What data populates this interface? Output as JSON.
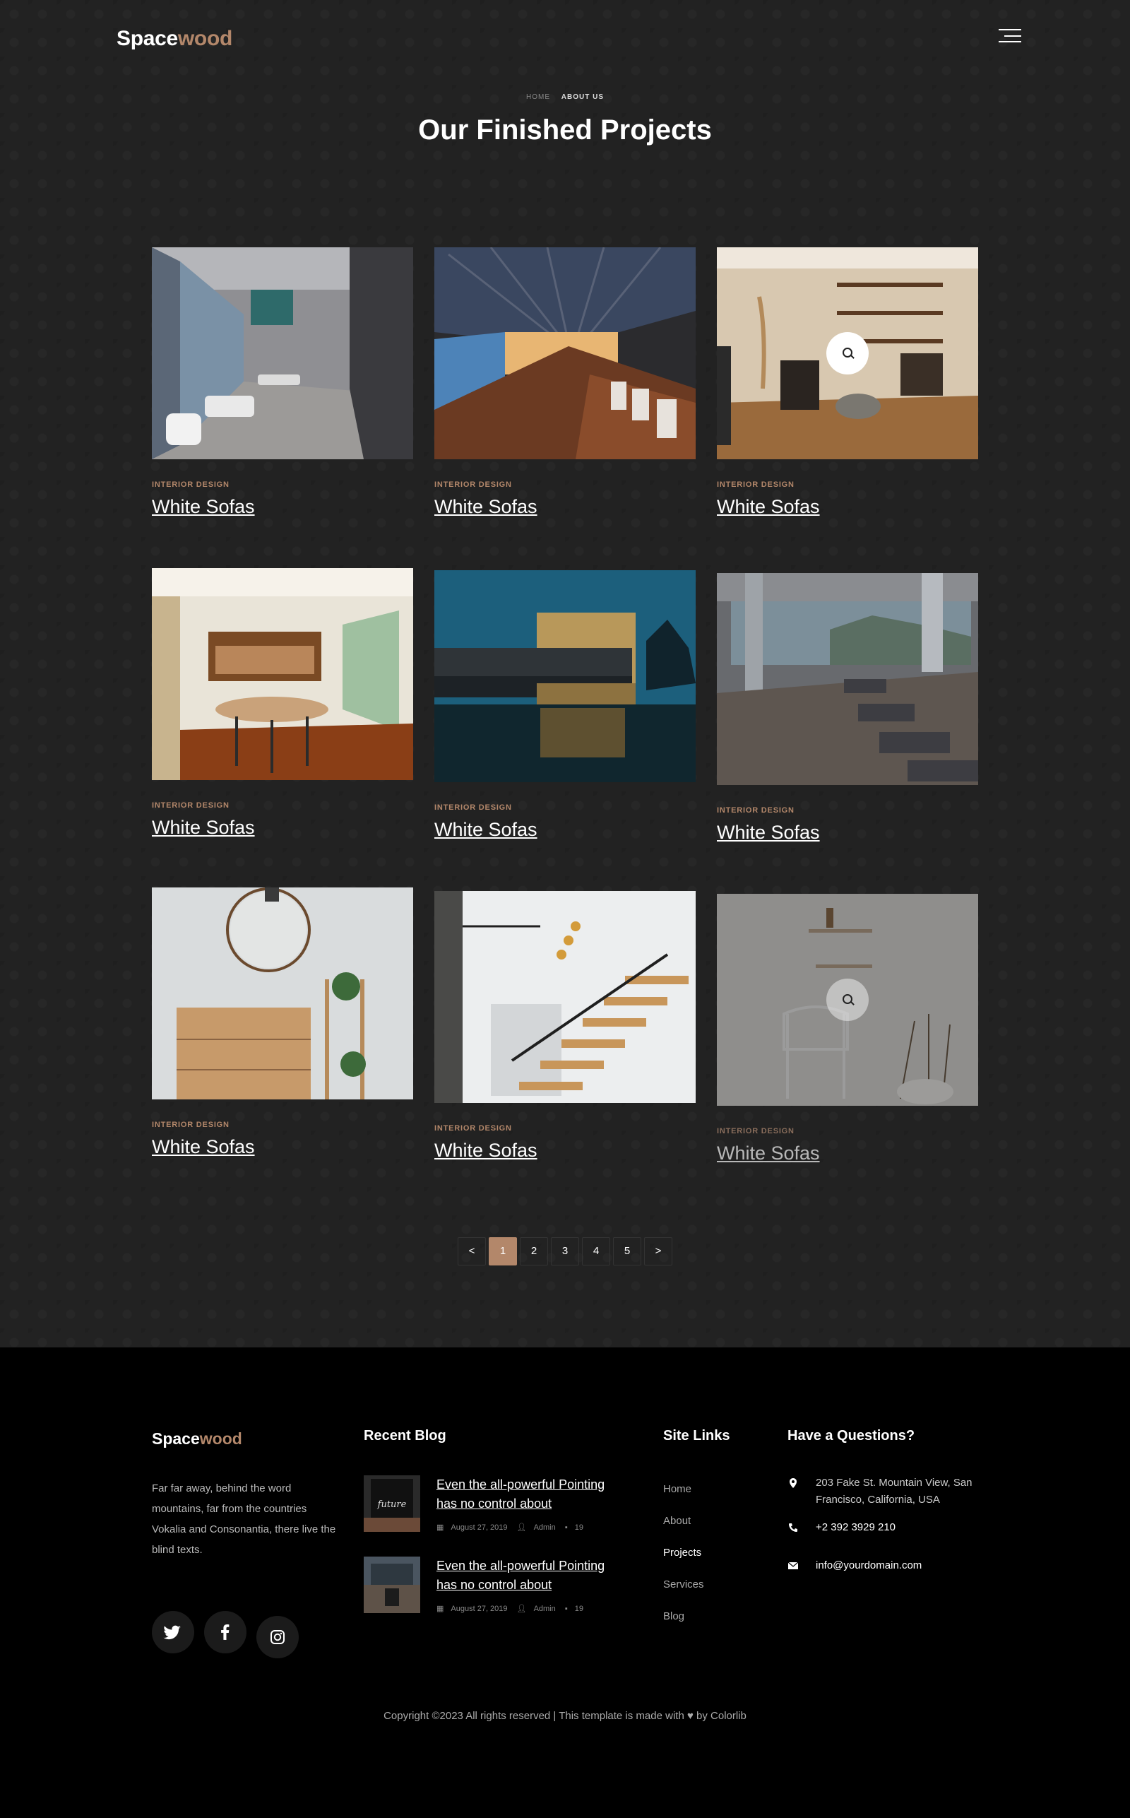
{
  "brand": {
    "part1": "Space",
    "part2": "wood"
  },
  "breadcrumb": {
    "home": "HOME",
    "current": "ABOUT US"
  },
  "page_title": "Our Finished Projects",
  "projects": [
    {
      "category": "INTERIOR DESIGN",
      "title": "White Sofas"
    },
    {
      "category": "INTERIOR DESIGN",
      "title": "White Sofas"
    },
    {
      "category": "INTERIOR DESIGN",
      "title": "White Sofas"
    },
    {
      "category": "INTERIOR DESIGN",
      "title": "White Sofas"
    },
    {
      "category": "INTERIOR DESIGN",
      "title": "White Sofas"
    },
    {
      "category": "INTERIOR DESIGN",
      "title": "White Sofas"
    },
    {
      "category": "INTERIOR DESIGN",
      "title": "White Sofas"
    },
    {
      "category": "INTERIOR DESIGN",
      "title": "White Sofas"
    },
    {
      "category": "INTERIOR DESIGN",
      "title": "White Sofas"
    }
  ],
  "pagination": {
    "prev": "<",
    "pages": [
      "1",
      "2",
      "3",
      "4",
      "5"
    ],
    "next": ">",
    "active": "1"
  },
  "footer": {
    "brand": {
      "part1": "Space",
      "part2": "wood"
    },
    "about_text": "Far far away, behind the word mountains, far from the countries Vokalia and Consonantia, there live the blind texts.",
    "social": [
      "twitter-icon",
      "facebook-icon",
      "instagram-icon"
    ],
    "recent_blog_heading": "Recent Blog",
    "posts": [
      {
        "title": "Even the all-powerful Pointing has no control about",
        "date": "August 27, 2019",
        "author": "Admin",
        "comments": "19"
      },
      {
        "title": "Even the all-powerful Pointing has no control about",
        "date": "August 27, 2019",
        "author": "Admin",
        "comments": "19"
      }
    ],
    "site_links_heading": "Site Links",
    "site_links": [
      "Home",
      "About",
      "Projects",
      "Services",
      "Blog"
    ],
    "contact_heading": "Have a Questions?",
    "address": "203 Fake St. Mountain View, San Francisco, California, USA",
    "phone": "+2 392 3929 210",
    "email": "info@yourdomain.com",
    "copyright": "Copyright ©2023 All rights reserved | This template is made with ♥ by Colorlib"
  },
  "colors": {
    "accent": "#b3876a",
    "background": "#222222",
    "footer": "#000000"
  }
}
